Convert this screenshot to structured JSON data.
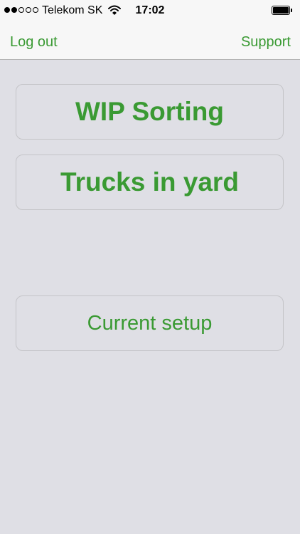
{
  "status_bar": {
    "carrier": "Telekom SK",
    "time": "17:02",
    "signal_strength": 2,
    "signal_max": 5,
    "wifi_icon": "wifi-icon",
    "battery_icon": "battery-full-icon"
  },
  "nav": {
    "left_label": "Log out",
    "right_label": "Support"
  },
  "menu": {
    "wip_sorting": "WIP Sorting",
    "trucks_in_yard": "Trucks in yard",
    "current_setup": "Current setup"
  },
  "colors": {
    "accent": "#3a9a33",
    "background": "#dfdfe5",
    "bar_background": "#f7f7f7",
    "button_border": "#c4c4c8"
  }
}
